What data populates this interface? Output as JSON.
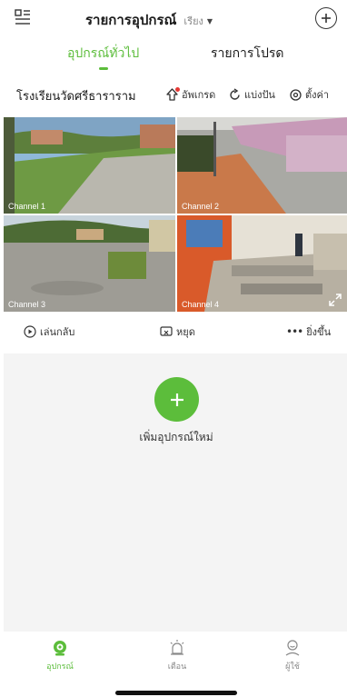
{
  "header": {
    "title": "รายการอุปกรณ์",
    "subtitle": "เรียง",
    "menu_icon": "grid-list-icon",
    "add_icon": "plus-circle-icon"
  },
  "tabs": [
    {
      "label": "อุปกรณ์ทั่วไป",
      "active": true
    },
    {
      "label": "รายการโปรด",
      "active": false
    }
  ],
  "site": {
    "name": "โรงเรียนวัดศรีธาราราม",
    "actions": [
      {
        "label": "อัพเกรด",
        "icon": "upgrade-icon"
      },
      {
        "label": "แบ่งปัน",
        "icon": "share-icon"
      },
      {
        "label": "ตั้งค่า",
        "icon": "settings-icon"
      }
    ]
  },
  "cameras": [
    {
      "label": "Channel 1",
      "selected": true
    },
    {
      "label": "Channel 2",
      "selected": false
    },
    {
      "label": "Channel 3",
      "selected": false
    },
    {
      "label": "Channel 4",
      "selected": false
    }
  ],
  "controls": {
    "play": "เล่นกลับ",
    "stop": "หยุด",
    "more": "ยิ่งขึ้น"
  },
  "add_device": {
    "label": "เพิ่มอุปกรณ์ใหม่"
  },
  "bottom_nav": [
    {
      "label": "อุปกรณ์",
      "icon": "camera-icon",
      "active": true
    },
    {
      "label": "เตือน",
      "icon": "alarm-icon",
      "active": false
    },
    {
      "label": "ผู้ใช้",
      "icon": "user-icon",
      "active": false
    }
  ],
  "colors": {
    "accent": "#5cbd3b",
    "background": "#ffffff",
    "panel": "#f4f4f4"
  }
}
